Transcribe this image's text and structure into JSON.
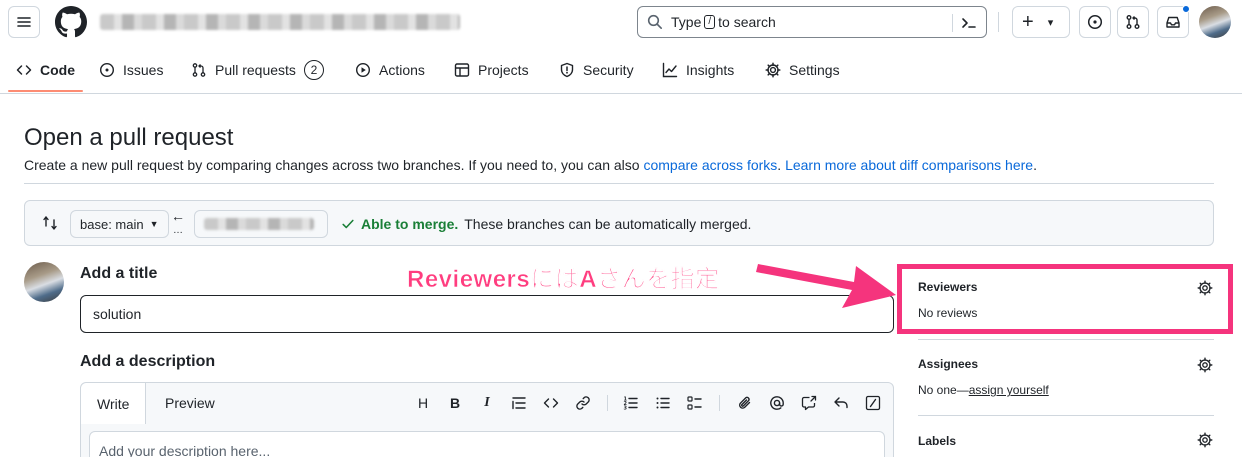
{
  "header": {
    "search_prefix": "Type",
    "search_slash": "/",
    "search_suffix": "to search",
    "new_button": "+",
    "new_caret": "▾"
  },
  "repo_nav": {
    "tabs": [
      {
        "label": "Code"
      },
      {
        "label": "Issues"
      },
      {
        "label": "Pull requests",
        "count": "2"
      },
      {
        "label": "Actions"
      },
      {
        "label": "Projects"
      },
      {
        "label": "Security"
      },
      {
        "label": "Insights"
      },
      {
        "label": "Settings"
      }
    ]
  },
  "page": {
    "title": "Open a pull request",
    "subtitle_text": "Create a new pull request by comparing changes across two branches. If you need to, you can also ",
    "link_forks": "compare across forks",
    "link_diff": "Learn more about diff comparisons here",
    "subtitle_end": "."
  },
  "compare": {
    "base_label": "base: main",
    "arrow": "←",
    "merge_status": "Able to merge.",
    "merge_text": "These branches can be automatically merged."
  },
  "form": {
    "title_heading": "Add a title",
    "title_value": "solution",
    "description_heading": "Add a description",
    "tab_write": "Write",
    "tab_preview": "Preview",
    "toolbar_heading": "H",
    "toolbar_bold": "B",
    "toolbar_italic": "I",
    "description_placeholder": "Add your description here..."
  },
  "annotation": {
    "text": "ReviewersにはAさんを指定"
  },
  "sidebar": {
    "reviewers_heading": "Reviewers",
    "reviewers_value": "No reviews",
    "assignees_heading": "Assignees",
    "assignees_prefix": "No one—",
    "assignees_link": "assign yourself",
    "labels_heading": "Labels"
  },
  "colors": {
    "accent_link": "#0969da",
    "merge_green": "#1a7f37",
    "annotation_pink": "#f5347d",
    "tab_underline": "#fd8c73"
  }
}
